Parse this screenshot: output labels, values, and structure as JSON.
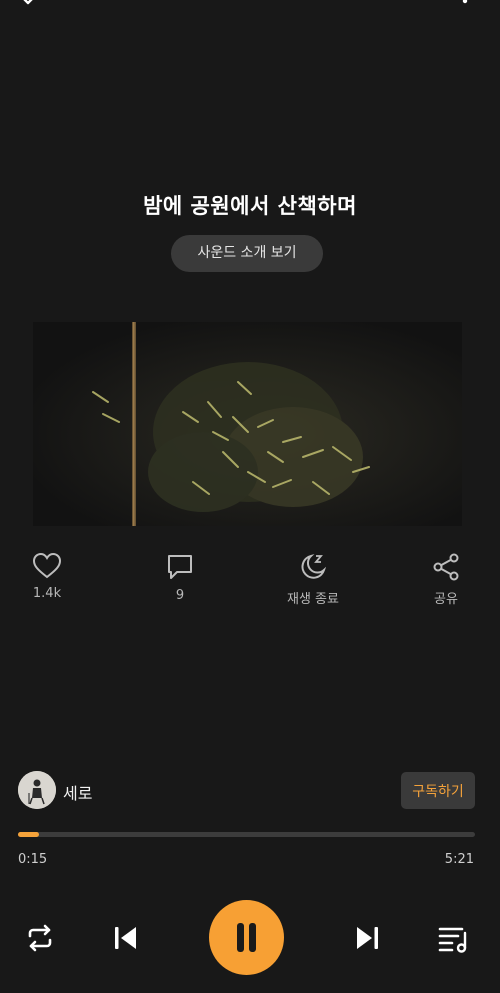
{
  "track": {
    "title": "밤에 공원에서 산책하며",
    "sound_intro_label": "사운드 소개 보기"
  },
  "actions": {
    "like_count": "1.4k",
    "comment_count": "9",
    "sleep_timer_label": "재생 종료",
    "share_label": "공유"
  },
  "creator": {
    "name": "세로",
    "subscribe_label": "구독하기"
  },
  "player": {
    "current_time": "0:15",
    "total_time": "5:21",
    "progress_fraction": 0.047,
    "state": "playing"
  },
  "colors": {
    "background": "#181818",
    "accent": "#f7a034"
  },
  "icons": {
    "top_left": "chevron-down-icon",
    "top_right": "more-vertical-icon",
    "like": "heart-icon",
    "comment": "comment-icon",
    "sleep": "moon-z-icon",
    "share": "share-icon",
    "repeat": "repeat-icon",
    "previous": "skip-previous-icon",
    "pause": "pause-icon",
    "next": "skip-next-icon",
    "playlist": "playlist-icon"
  }
}
